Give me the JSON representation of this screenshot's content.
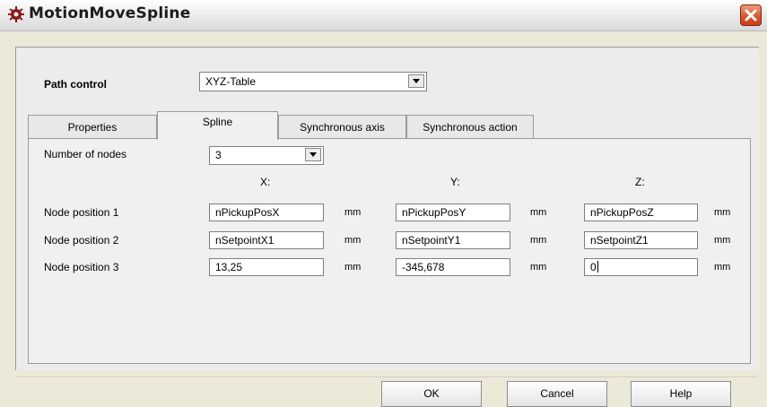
{
  "window": {
    "title": "MotionMoveSpline",
    "app_icon": "robot-gear-icon",
    "close_icon": "close-icon"
  },
  "path_control": {
    "label": "Path control",
    "value": "XYZ-Table"
  },
  "tabs": [
    {
      "label": "Properties"
    },
    {
      "label": "Spline",
      "active": true
    },
    {
      "label": "Synchronous axis"
    },
    {
      "label": "Synchronous action"
    }
  ],
  "spline": {
    "nodes_label": "Number of nodes",
    "nodes_value": "3",
    "headers": {
      "x": "X:",
      "y": "Y:",
      "z": "Z:"
    },
    "unit": "mm",
    "rows": [
      {
        "label": "Node position 1",
        "x": "nPickupPosX",
        "y": "nPickupPosY",
        "z": "nPickupPosZ"
      },
      {
        "label": "Node position 2",
        "x": "nSetpointX1",
        "y": "nSetpointY1",
        "z": "nSetpointZ1"
      },
      {
        "label": "Node position 3",
        "x": "13,25",
        "y": "-345,678",
        "z": "0"
      }
    ]
  },
  "buttons": {
    "ok": "OK",
    "cancel": "Cancel",
    "help": "Help"
  }
}
